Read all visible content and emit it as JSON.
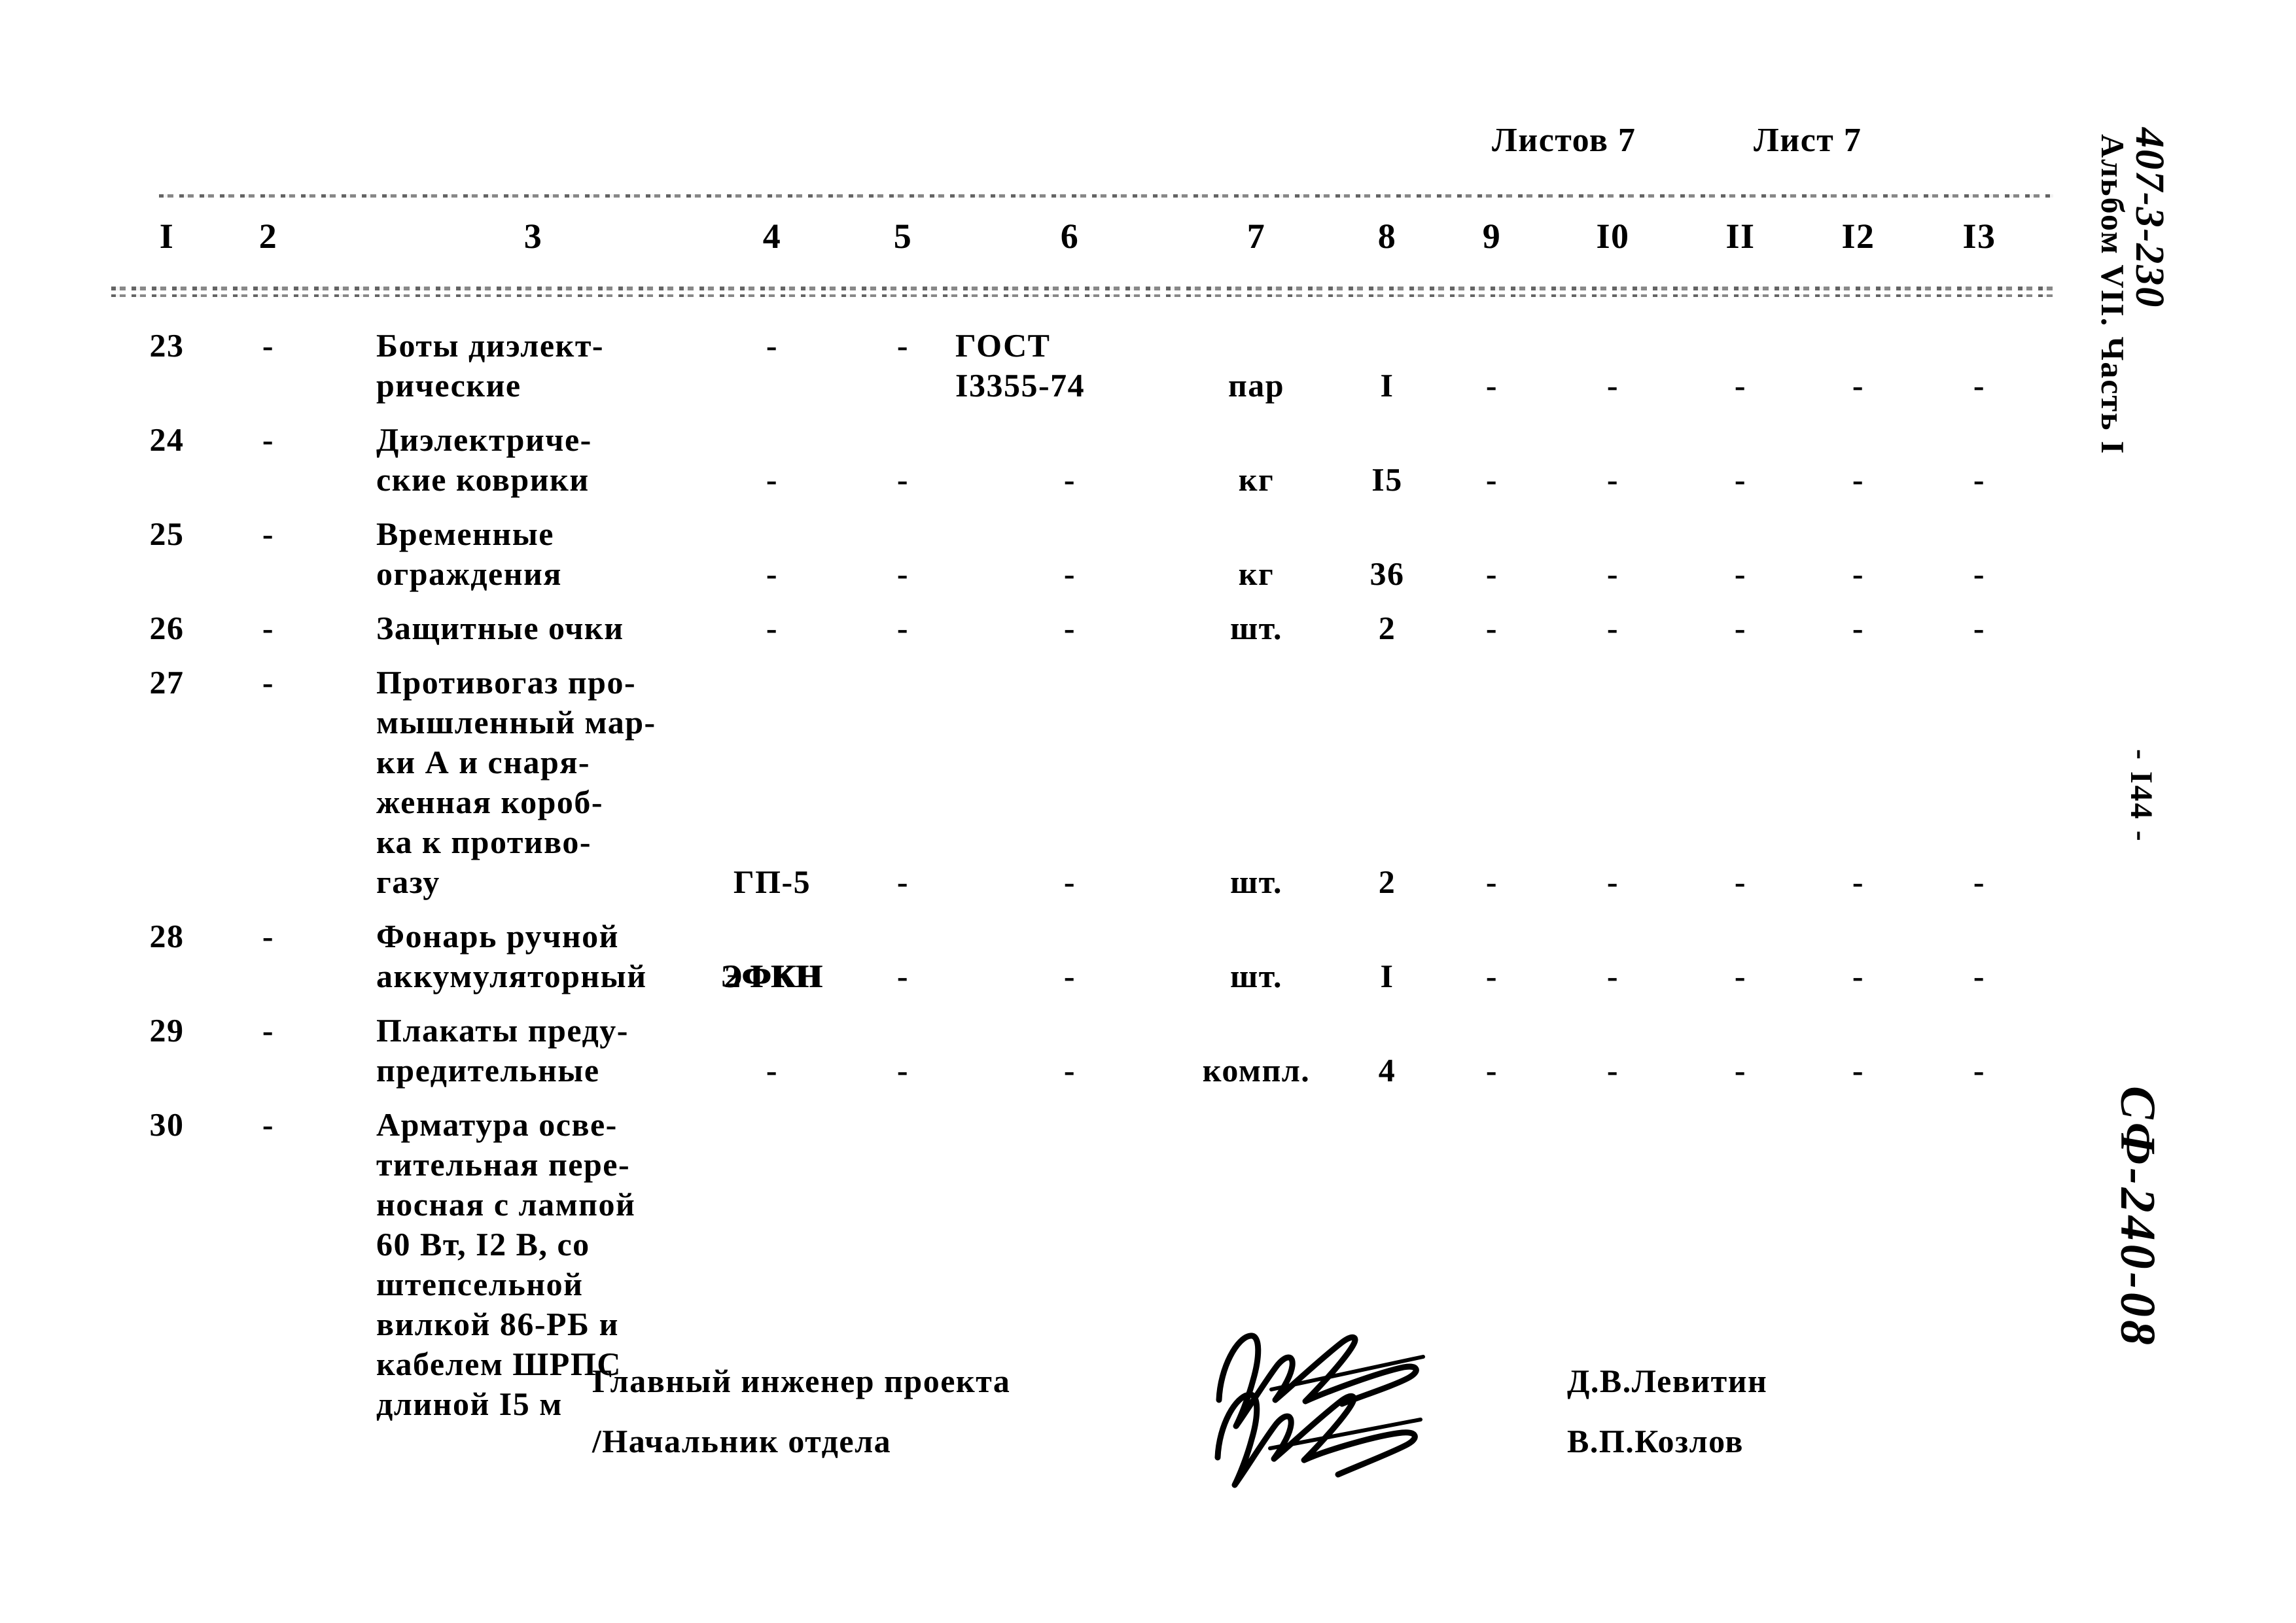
{
  "sheet_header": {
    "total_sheets_label": "Листов 7",
    "current_sheet_label": "Лист 7"
  },
  "table": {
    "column_numbers": [
      "I",
      "2",
      "3",
      "4",
      "5",
      "6",
      "7",
      "8",
      "9",
      "I0",
      "II",
      "I2",
      "I3"
    ],
    "dash": "-",
    "rows": [
      {
        "c1": "23",
        "c2": "-",
        "c3": [
          "Боты диэлект-",
          "рические"
        ],
        "c4": "-",
        "c5": "-",
        "c6": [
          "ГОСТ",
          "I3355-74"
        ],
        "c7": "пар",
        "c8": "I",
        "c9": "-",
        "c10": "-",
        "c11": "-",
        "c12": "-",
        "c13": "-"
      },
      {
        "c1": "24",
        "c2": "-",
        "c3": [
          "Диэлектриче-",
          "ские коврики"
        ],
        "c4": "-",
        "c5": "-",
        "c6": "-",
        "c7": "кг",
        "c8": "I5",
        "c9": "-",
        "c10": "-",
        "c11": "-",
        "c12": "-",
        "c13": "-"
      },
      {
        "c1": "25",
        "c2": "-",
        "c3": [
          "Временные",
          "ограждения"
        ],
        "c4": "-",
        "c5": "-",
        "c6": "-",
        "c7": "кг",
        "c8": "36",
        "c9": "-",
        "c10": "-",
        "c11": "-",
        "c12": "-",
        "c13": "-"
      },
      {
        "c1": "26",
        "c2": "-",
        "c3": [
          "Защитные очки"
        ],
        "c4": "-",
        "c5": "-",
        "c6": "-",
        "c7": "шт.",
        "c8": "2",
        "c9": "-",
        "c10": "-",
        "c11": "-",
        "c12": "-",
        "c13": "-"
      },
      {
        "c1": "27",
        "c2": "-",
        "c3": [
          "Противогаз про-",
          "мышленный мар-",
          "ки А и снаря-",
          "женная короб-",
          "ка к противо-",
          "газу"
        ],
        "c4": "ГП-5",
        "c5": "-",
        "c6": "-",
        "c7": "шт.",
        "c8": "2",
        "c9": "-",
        "c10": "-",
        "c11": "-",
        "c12": "-",
        "c13": "-"
      },
      {
        "c1": "28",
        "c2": "-",
        "c3": [
          "Фонарь ручной",
          "аккумуляторный"
        ],
        "c4_overstruck_a": "ЭФКН",
        "c4_overstruck_b": "2ФКН",
        "c5": "-",
        "c6": "-",
        "c7": "шт.",
        "c8": "I",
        "c9": "-",
        "c10": "-",
        "c11": "-",
        "c12": "-",
        "c13": "-"
      },
      {
        "c1": "29",
        "c2": "-",
        "c3": [
          "Плакаты преду-",
          "предительные"
        ],
        "c4": "-",
        "c5": "-",
        "c6": "-",
        "c7": "компл.",
        "c8": "4",
        "c9": "-",
        "c10": "-",
        "c11": "-",
        "c12": "-",
        "c13": "-"
      },
      {
        "c1": "30",
        "c2": "-",
        "c3": [
          "Арматура осве-",
          "тительная пере-",
          "носная с лампой",
          "60 Вт, I2 В, со",
          "штепсельной",
          "вилкой 86-РБ и",
          "кабелем ШРПС",
          "длиной I5 м"
        ],
        "c4": "",
        "c5": "",
        "c6": "",
        "c7": "",
        "c8": "",
        "c9": "",
        "c10": "",
        "c11": "",
        "c12": "",
        "c13": ""
      }
    ]
  },
  "signature_block": {
    "role_line_1": "Главный инженер проекта",
    "role_line_2": "/Начальник отдела",
    "name_line_1": "Д.В.Левитин",
    "name_line_2": "В.П.Козлов"
  },
  "margin_annotations": {
    "album_code": "407-3-230",
    "album_part": "Альбом VII. Часть I",
    "page_number": "- I44 -",
    "document_code": "СФ-240-08"
  }
}
